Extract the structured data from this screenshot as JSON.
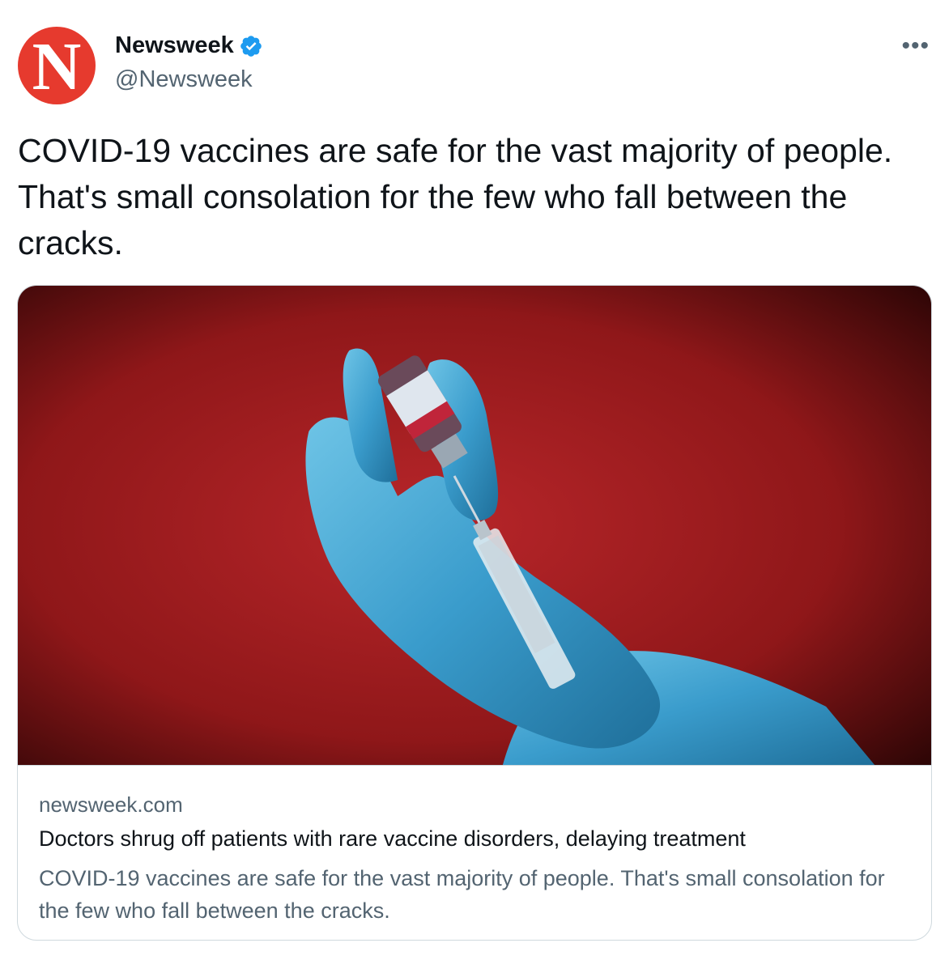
{
  "author": {
    "avatar_letter": "N",
    "display_name": "Newsweek",
    "handle": "@Newsweek",
    "verified": true
  },
  "tweet": {
    "text": "COVID-19 vaccines are safe for the vast majority of people. That's small consolation for the few who fall between the cracks."
  },
  "card": {
    "domain": "newsweek.com",
    "title": "Doctors shrug off patients with rare vaccine disorders, delaying treatment",
    "description": "COVID-19 vaccines are safe for the vast majority of people. That's small consolation for the few who fall between the cracks.",
    "image_subject": "gloved hands filling syringe from vaccine vial on red background"
  },
  "icons": {
    "verified": "verified-badge-icon",
    "more": "more-options-icon"
  },
  "colors": {
    "avatar_bg": "#e63a2e",
    "verified_blue": "#1d9bf0",
    "secondary_text": "#536471",
    "primary_text": "#0f1419",
    "border": "#cfd9de"
  }
}
